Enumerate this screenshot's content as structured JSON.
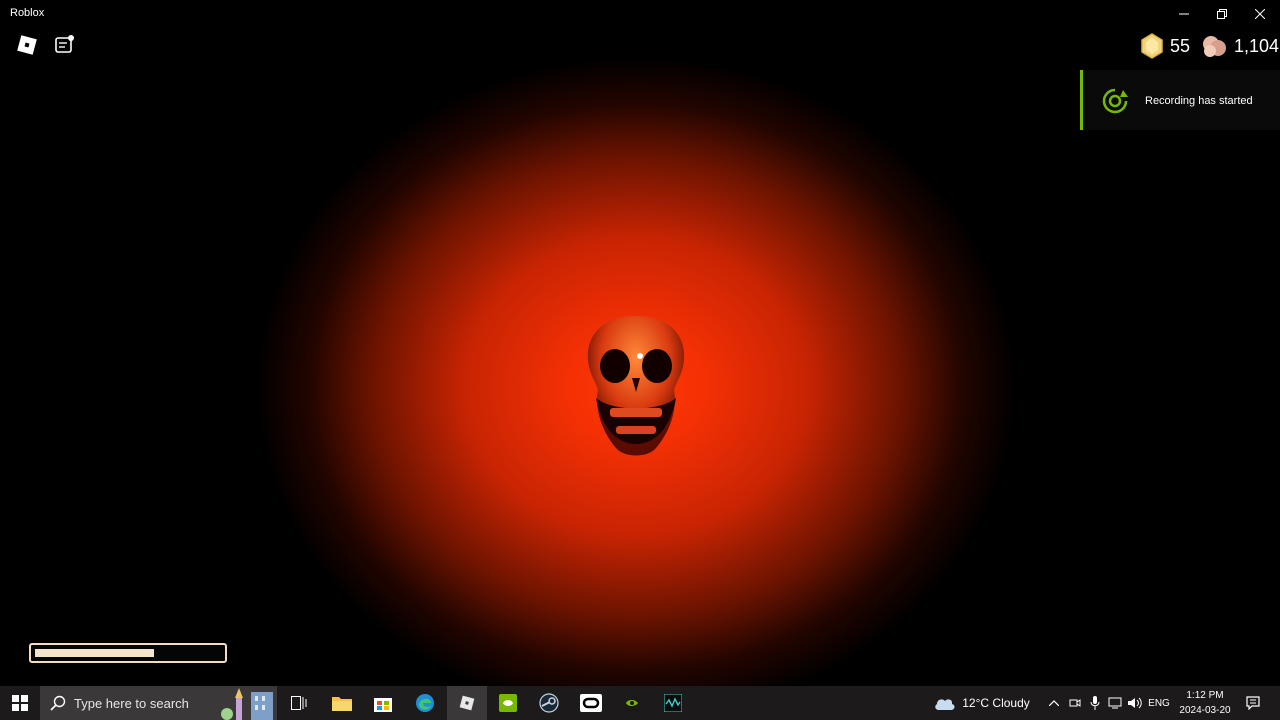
{
  "window": {
    "title": "Roblox",
    "controls": [
      "minimize-icon",
      "restore-icon",
      "close-icon"
    ]
  },
  "hud": {
    "coins": "55",
    "gems": "1,104",
    "health_fraction": 0.64
  },
  "notification": {
    "text": "Recording has started",
    "accent_color": "#76b900"
  },
  "taskbar": {
    "search_placeholder": "Type here to search",
    "weather": "12°C  Cloudy",
    "language": "ENG",
    "time": "1:12 PM",
    "date": "2024-03-20",
    "pinned_apps": [
      "task-view-icon",
      "file-explorer-icon",
      "microsoft-store-icon",
      "edge-icon",
      "roblox-icon",
      "geforce-experience-icon",
      "steam-icon",
      "oculus-icon",
      "nvidia-icon",
      "waves-icon"
    ]
  },
  "colors": {
    "glow": "#ff3a06",
    "taskbar": "#1c1a1b",
    "health_border": "#f2dcc4"
  }
}
